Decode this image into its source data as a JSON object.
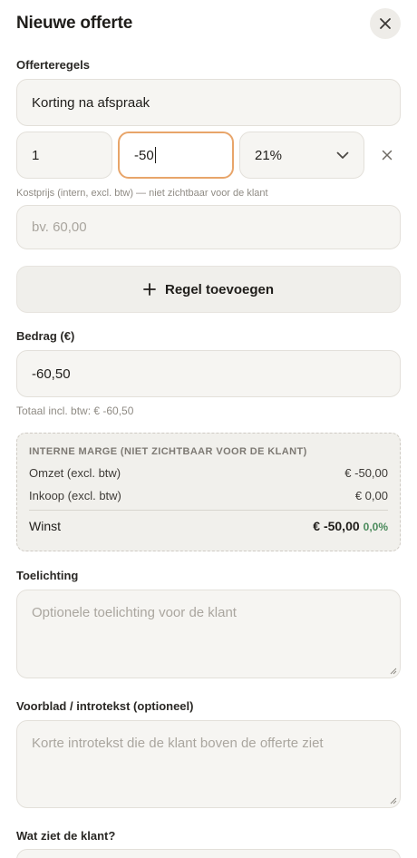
{
  "dialog": {
    "title": "Nieuwe offerte",
    "close_icon": "close-icon"
  },
  "lines": {
    "section_label": "Offerteregels",
    "description": "Korting na afspraak",
    "quantity": "1",
    "price": "-50",
    "vat": "21%",
    "vat_options": [
      "21%"
    ],
    "cost_hint": "Kostprijs (intern, excl. btw) — niet zichtbaar voor de klant",
    "cost_placeholder": "bv. 60,00",
    "add_label": "Regel toevoegen"
  },
  "amount": {
    "label": "Bedrag (€)",
    "value": "-60,50",
    "total_text": "Totaal incl. btw: € -60,50"
  },
  "margin": {
    "heading": "INTERNE MARGE (NIET ZICHTBAAR VOOR DE KLANT)",
    "revenue_label": "Omzet (excl. btw)",
    "revenue_value": "€ -50,00",
    "cost_label": "Inkoop (excl. btw)",
    "cost_value": "€ 0,00",
    "profit_label": "Winst",
    "profit_value": "€ -50,00",
    "profit_pct": "0,0%",
    "pct_color": "#4a8a5b"
  },
  "explanation": {
    "label": "Toelichting",
    "placeholder": "Optionele toelichting voor de klant"
  },
  "intro": {
    "label": "Voorblad / introtekst (optioneel)",
    "placeholder": "Korte introtekst die de klant boven de offerte ziet"
  },
  "client_view": {
    "label": "Wat ziet de klant?"
  },
  "colors": {
    "accent_focus": "#e8a56a",
    "field_bg": "#f6f5f2"
  }
}
